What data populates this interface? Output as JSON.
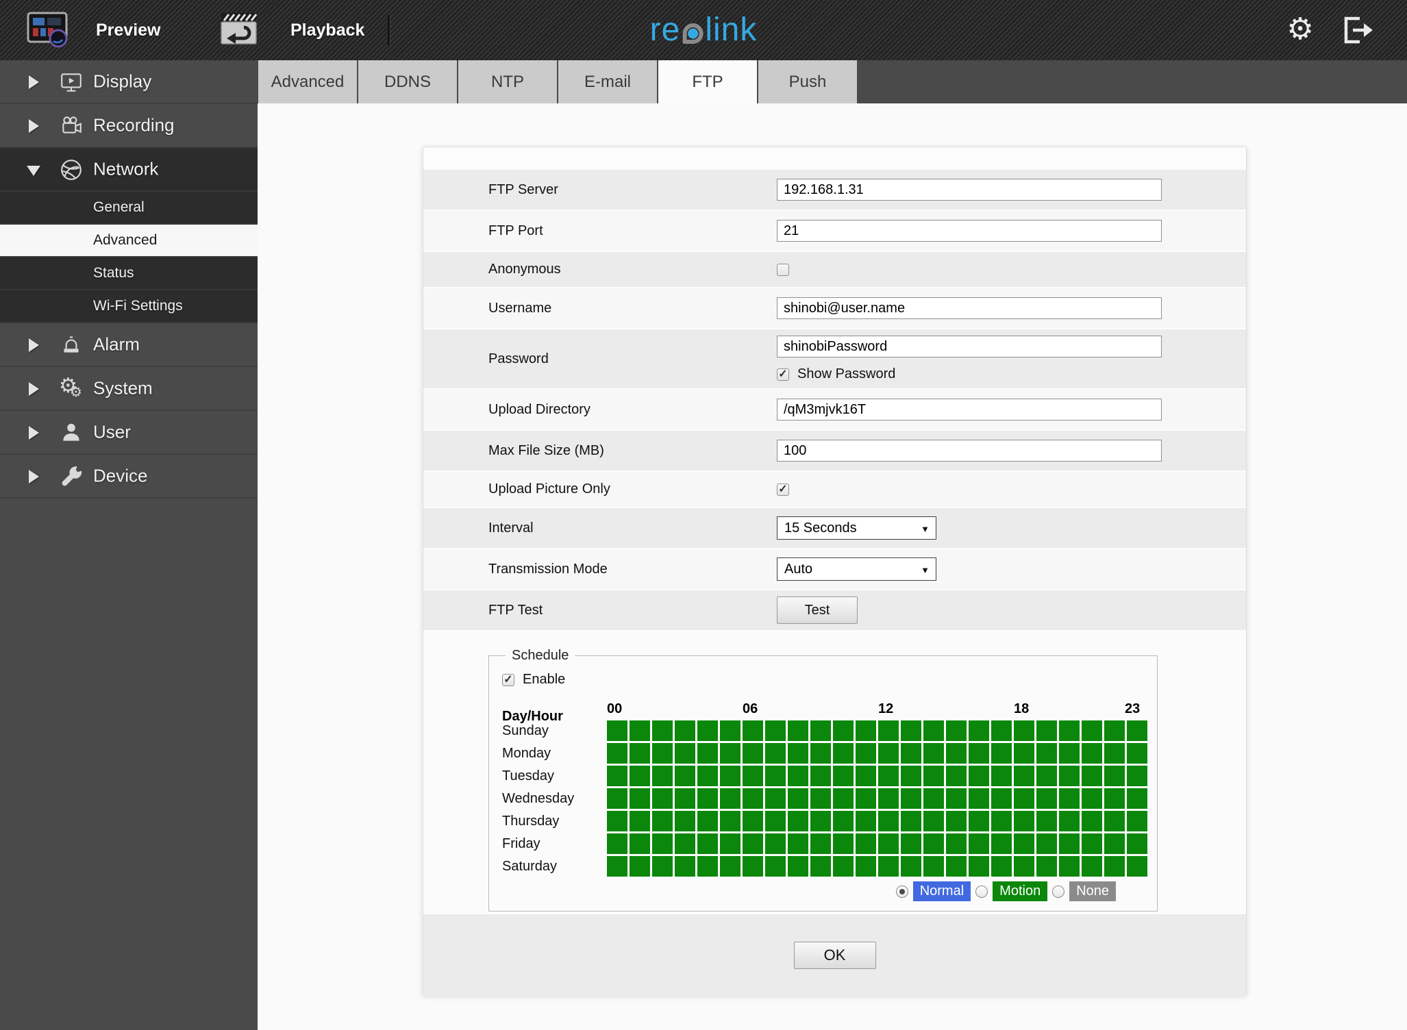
{
  "topbar": {
    "preview_label": "Preview",
    "playback_label": "Playback",
    "logo_text_1": "re",
    "logo_text_2": "link",
    "brand_color": "#35a9e2"
  },
  "sidebar": {
    "items": [
      {
        "label": "Display",
        "expanded": false
      },
      {
        "label": "Recording",
        "expanded": false
      },
      {
        "label": "Network",
        "expanded": true
      },
      {
        "label": "Alarm",
        "expanded": false
      },
      {
        "label": "System",
        "expanded": false
      },
      {
        "label": "User",
        "expanded": false
      },
      {
        "label": "Device",
        "expanded": false
      }
    ],
    "network_children": [
      {
        "label": "General",
        "selected": false
      },
      {
        "label": "Advanced",
        "selected": true
      },
      {
        "label": "Status",
        "selected": false
      },
      {
        "label": "Wi-Fi Settings",
        "selected": false
      }
    ]
  },
  "tabs": {
    "items": [
      "Advanced",
      "DDNS",
      "NTP",
      "E-mail",
      "FTP",
      "Push"
    ],
    "active": "FTP"
  },
  "form": {
    "ftp_server": {
      "label": "FTP Server",
      "value": "192.168.1.31"
    },
    "ftp_port": {
      "label": "FTP Port",
      "value": "21"
    },
    "anonymous": {
      "label": "Anonymous",
      "checked": false
    },
    "username": {
      "label": "Username",
      "value": "shinobi@user.name"
    },
    "password": {
      "label": "Password",
      "value": "shinobiPassword"
    },
    "show_password": {
      "label": "Show Password",
      "checked": true
    },
    "upload_directory": {
      "label": "Upload Directory",
      "value": "/qM3mjvk16T"
    },
    "max_file_size": {
      "label": "Max File Size (MB)",
      "value": "100"
    },
    "upload_picture_only": {
      "label": "Upload Picture Only",
      "checked": true
    },
    "interval": {
      "label": "Interval",
      "value": "15 Seconds"
    },
    "transmission_mode": {
      "label": "Transmission Mode",
      "value": "Auto"
    },
    "ftp_test": {
      "label": "FTP Test",
      "button_label": "Test"
    }
  },
  "schedule": {
    "legend": "Schedule",
    "enable": {
      "label": "Enable",
      "checked": true
    },
    "day_hour_label": "Day/Hour",
    "hour_labels": [
      "00",
      "06",
      "12",
      "18",
      "23"
    ],
    "days": [
      "Sunday",
      "Monday",
      "Tuesday",
      "Wednesday",
      "Thursday",
      "Friday",
      "Saturday"
    ],
    "hours_per_day": 24,
    "all_cells_selected": true,
    "cell_color": "#0b870b",
    "modes": [
      {
        "label": "Normal",
        "color": "#4169e1",
        "selected": true
      },
      {
        "label": "Motion",
        "color": "#0b870b",
        "selected": false
      },
      {
        "label": "None",
        "color": "#8b8b8b",
        "selected": false
      }
    ]
  },
  "ok_label": "OK"
}
